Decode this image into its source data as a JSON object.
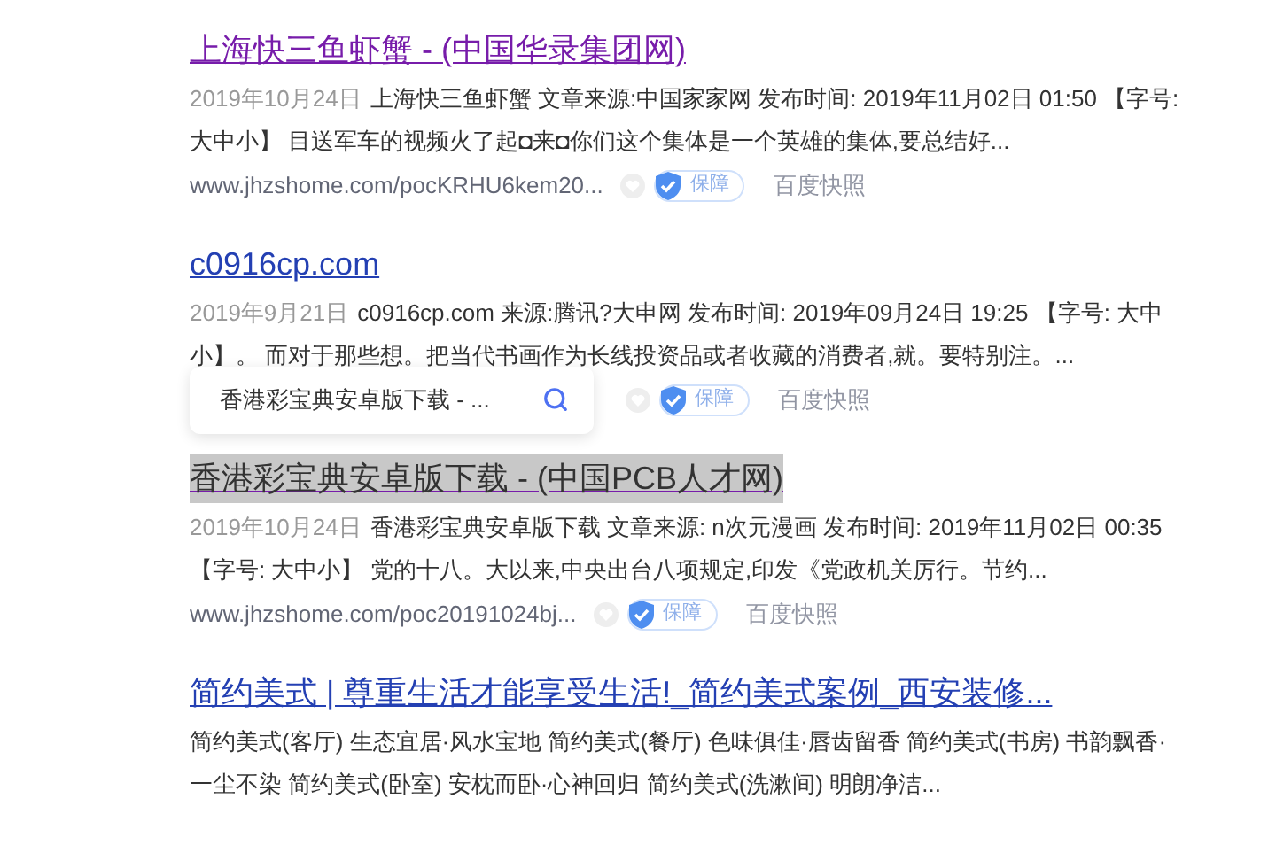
{
  "results": [
    {
      "title": "上海快三鱼虾蟹 - (中国华录集团网)",
      "visited": true,
      "highlighted": false,
      "date": "2019年10月24日",
      "snippet_lines": [
        "上海快三鱼虾蟹 文章来源:中国家家网 发布时间: 2019年11月02日 01:50 【字号:",
        "大中小】 目送军车的视频火了起◘来◘你们这个集体是一个英雄的集体,要总结好..."
      ],
      "url": "www.jhzshome.com/pocKRHU6kem20...",
      "badge": "保障",
      "snapshot": "百度快照"
    },
    {
      "title": "c0916cp.com",
      "visited": false,
      "highlighted": false,
      "date": "2019年9月21日",
      "snippet_lines": [
        "c0916cp.com 来源:腾讯?大申网 发布时间: 2019年09月24日 19:25 【字号: 大中",
        "小】。 而对于那些想。把当代书画作为长线投资品或者收藏的消费者,就。要特别注。..."
      ],
      "popup": {
        "text": "香港彩宝典安卓版下载 - ..."
      },
      "badge": "保障",
      "snapshot": "百度快照"
    },
    {
      "title": "香港彩宝典安卓版下载 - (中国PCB人才网)",
      "visited": true,
      "highlighted": true,
      "date": "2019年10月24日",
      "snippet_lines": [
        "香港彩宝典安卓版下载 文章来源: n次元漫画 发布时间: 2019年11月02日 00:35",
        "【字号: 大中小】 党的十八。大以来,中央出台八项规定,印发《党政机关厉行。节约..."
      ],
      "url": "www.jhzshome.com/poc20191024bj...",
      "badge": "保障",
      "snapshot": "百度快照"
    },
    {
      "title": "简约美式 | 尊重生活才能享受生活!_简约美式案例_西安装修...",
      "visited": false,
      "highlighted": false,
      "snippet_lines": [
        "简约美式(客厅) 生态宜居·风水宝地 简约美式(餐厅) 色味俱佳·唇齿留香 简约美式(书房) 书韵飘香·",
        "一尘不染 简约美式(卧室) 安枕而卧·心神回归 简约美式(洗漱间) 明朗净洁..."
      ]
    }
  ]
}
